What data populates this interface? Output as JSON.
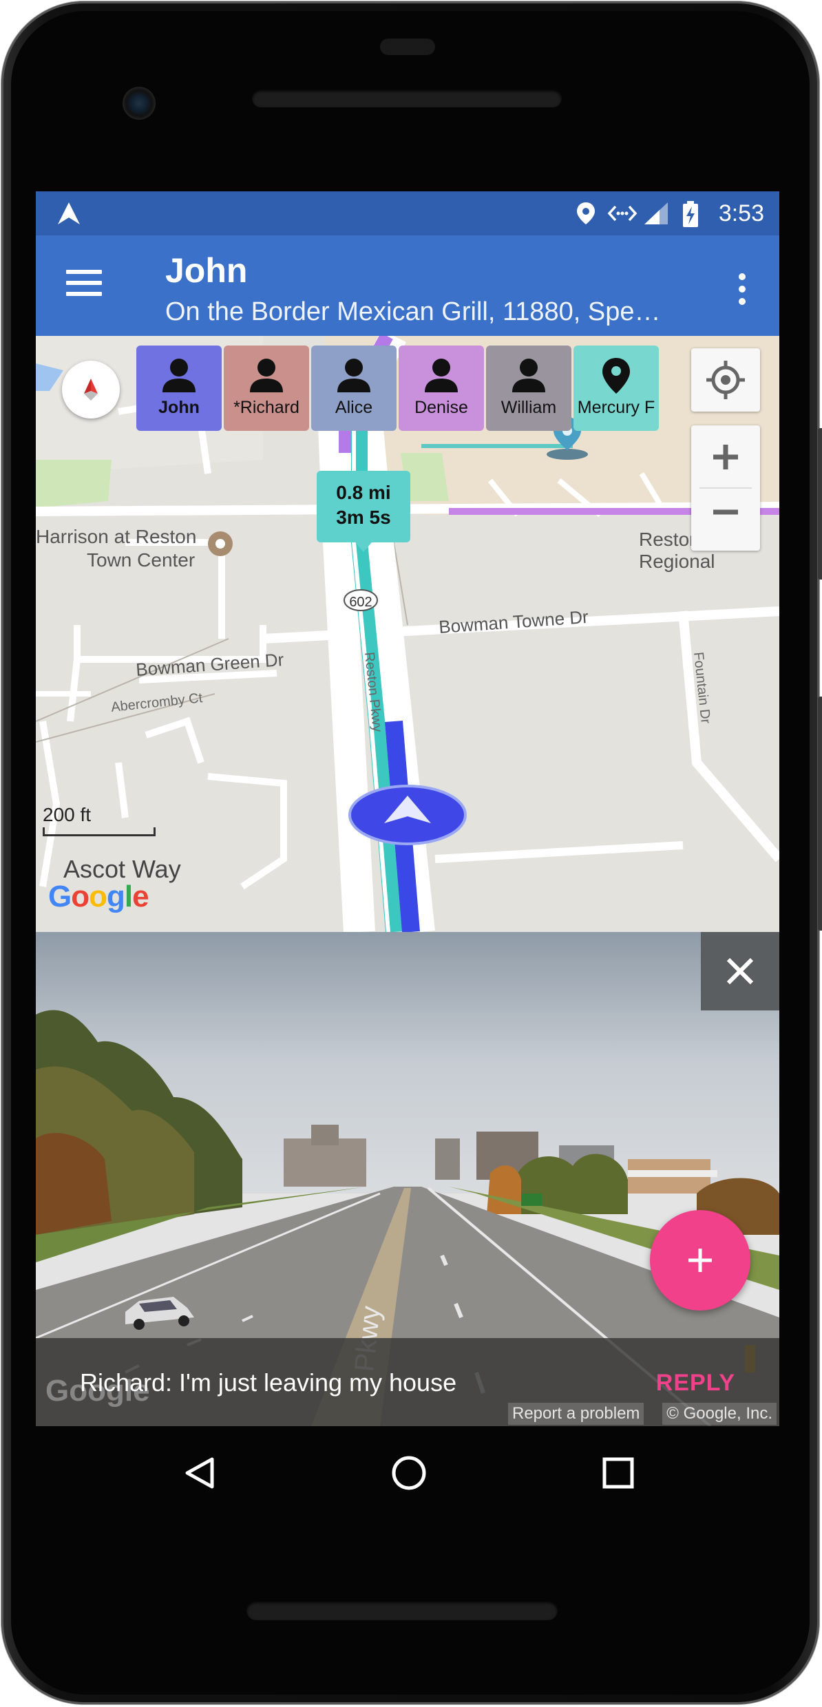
{
  "status_bar": {
    "time": "3:53"
  },
  "app_bar": {
    "title": "John",
    "subtitle": "On the Border Mexican Grill, 11880, Spe…"
  },
  "contacts": [
    {
      "name": "John",
      "color": "#6f72e0",
      "icon": "person-icon",
      "selected": true
    },
    {
      "name": "*Richard",
      "color": "#c9908c",
      "icon": "person-icon",
      "selected": false
    },
    {
      "name": "Alice",
      "color": "#8fa0c8",
      "icon": "person-icon",
      "selected": false
    },
    {
      "name": "Denise",
      "color": "#c991dc",
      "icon": "person-icon",
      "selected": false
    },
    {
      "name": "William",
      "color": "#9a949e",
      "icon": "person-icon",
      "selected": false
    },
    {
      "name": "Mercury F",
      "color": "#78d8cf",
      "icon": "map-pin-icon",
      "selected": false
    }
  ],
  "map": {
    "route_distance": "0.8 mi",
    "route_time": "3m 5s",
    "scale_label": "200 ft",
    "route_shield": "602",
    "labels": {
      "harrison_1": "Harrison at Reston",
      "harrison_2": "Town Center",
      "reston_regional": "Reston Regional",
      "bowman_towne": "Bowman Towne Dr",
      "bowman_green": "Bowman Green Dr",
      "abercromby": "Abercromby Ct",
      "reston_pkwy": "Reston Pkwy",
      "fountain": "Fountain Dr",
      "ascot": "Ascot Way"
    },
    "google_logo": "Google"
  },
  "street_view": {
    "message": "Richard: I'm just leaving my house",
    "reply_label": "REPLY",
    "report_label": "Report a problem",
    "copyright": "© Google, Inc.",
    "watermark": "Google"
  },
  "colors": {
    "status_bar": "#2f5fae",
    "app_bar": "#3b71c9",
    "fab": "#f0418a",
    "route": "#3dc7c1"
  }
}
